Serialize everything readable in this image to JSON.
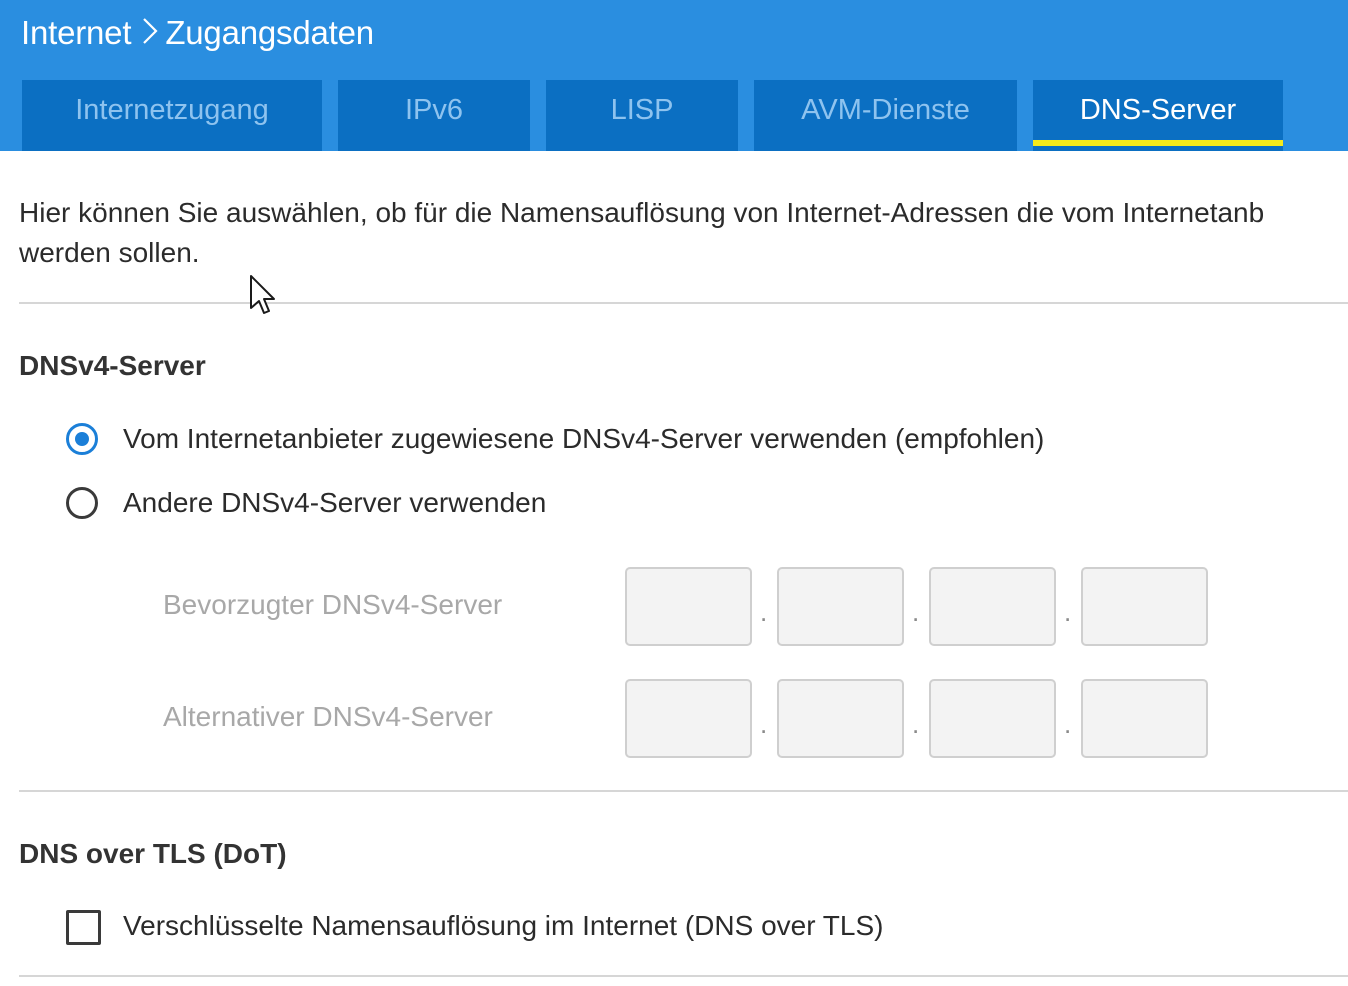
{
  "header": {
    "breadcrumb": {
      "section": "Internet",
      "separator": ">",
      "page": "Zugangsdaten"
    },
    "tabs": [
      {
        "label": "Internetzugang",
        "active": false
      },
      {
        "label": "IPv6",
        "active": false
      },
      {
        "label": "LISP",
        "active": false
      },
      {
        "label": "AVM-Dienste",
        "active": false
      },
      {
        "label": "DNS-Server",
        "active": true
      }
    ]
  },
  "intro": {
    "line1": "Hier können Sie auswählen, ob für die Namensauflösung von Internet-Adressen die vom Internetanb",
    "line2": "werden sollen."
  },
  "dnsv4": {
    "title": "DNSv4-Server",
    "options": [
      {
        "label": "Vom Internetanbieter zugewiesene DNSv4-Server verwenden (empfohlen)",
        "checked": true
      },
      {
        "label": "Andere DNSv4-Server verwenden",
        "checked": false
      }
    ],
    "preferred": {
      "label": "Bevorzugter DNSv4-Server",
      "octets": [
        "",
        "",
        "",
        ""
      ]
    },
    "alternative": {
      "label": "Alternativer DNSv4-Server",
      "octets": [
        "",
        "",
        "",
        ""
      ]
    },
    "octet_separator": "."
  },
  "dot": {
    "title": "DNS over TLS (DoT)",
    "checkbox_label": "Verschlüsselte Namensauflösung im Internet (DNS over TLS)",
    "checked": false
  },
  "colors": {
    "header_bg": "#2a8ee0",
    "tab_bg": "#0b6fc2",
    "tab_active_underline": "#f5ea1b",
    "radio_checked": "#1b7fd8"
  }
}
